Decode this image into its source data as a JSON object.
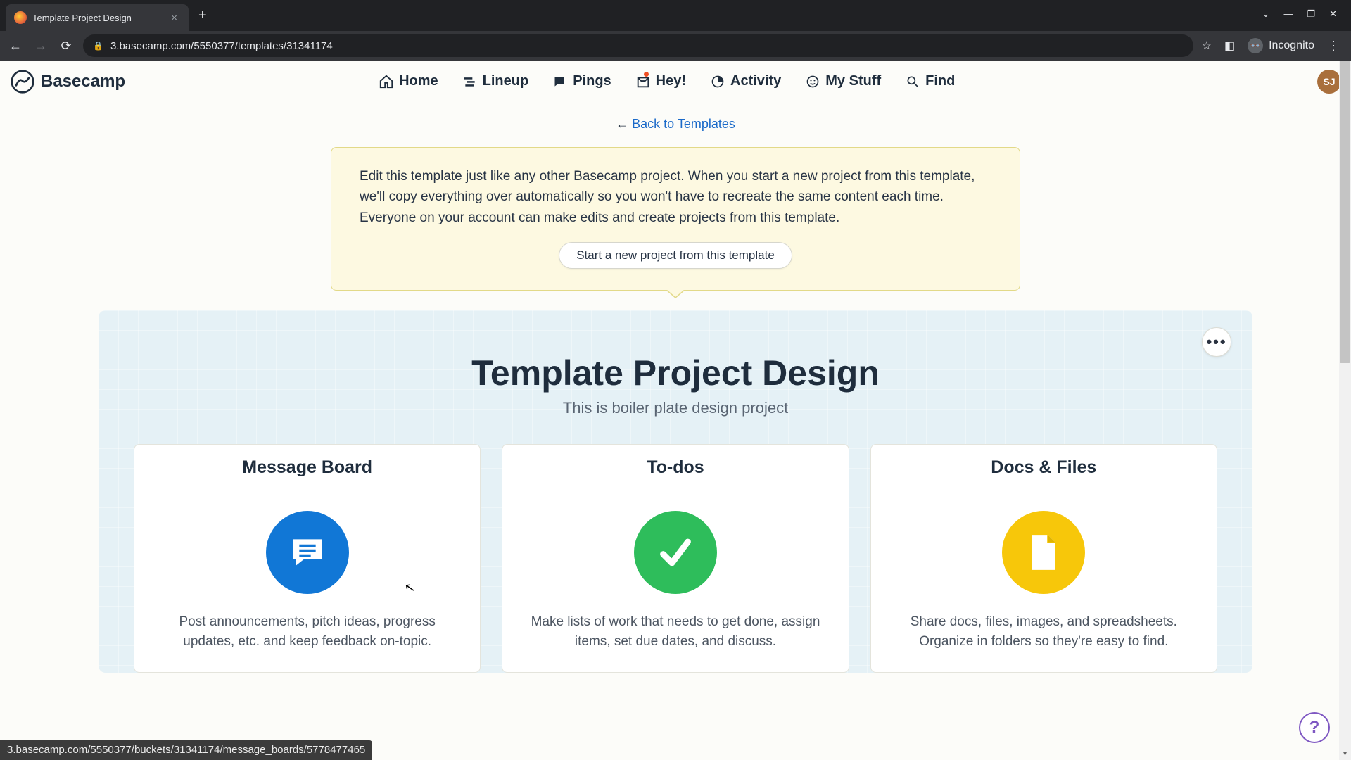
{
  "browser": {
    "tab_title": "Template Project Design",
    "url": "3.basecamp.com/5550377/templates/31341174",
    "incognito_label": "Incognito"
  },
  "nav": {
    "logo": "Basecamp",
    "items": [
      "Home",
      "Lineup",
      "Pings",
      "Hey!",
      "Activity",
      "My Stuff",
      "Find"
    ],
    "avatar": "SJ"
  },
  "back": {
    "arrow": "← ",
    "label": "Back to Templates"
  },
  "notice": {
    "text": "Edit this template just like any other Basecamp project. When you start a new project from this template, we'll copy everything over automatically so you won't have to recreate the same content each time. Everyone on your account can make edits and create projects from this template.",
    "button": "Start a new project from this template"
  },
  "template": {
    "title": "Template Project Design",
    "subtitle": "This is boiler plate design project"
  },
  "cards": [
    {
      "title": "Message Board",
      "desc": "Post announcements, pitch ideas, progress updates, etc. and keep feedback on-topic."
    },
    {
      "title": "To-dos",
      "desc": "Make lists of work that needs to get done, assign items, set due dates, and discuss."
    },
    {
      "title": "Docs & Files",
      "desc": "Share docs, files, images, and spreadsheets. Organize in folders so they're easy to find."
    }
  ],
  "status_link": "3.basecamp.com/5550377/buckets/31341174/message_boards/5778477465",
  "help": "?"
}
